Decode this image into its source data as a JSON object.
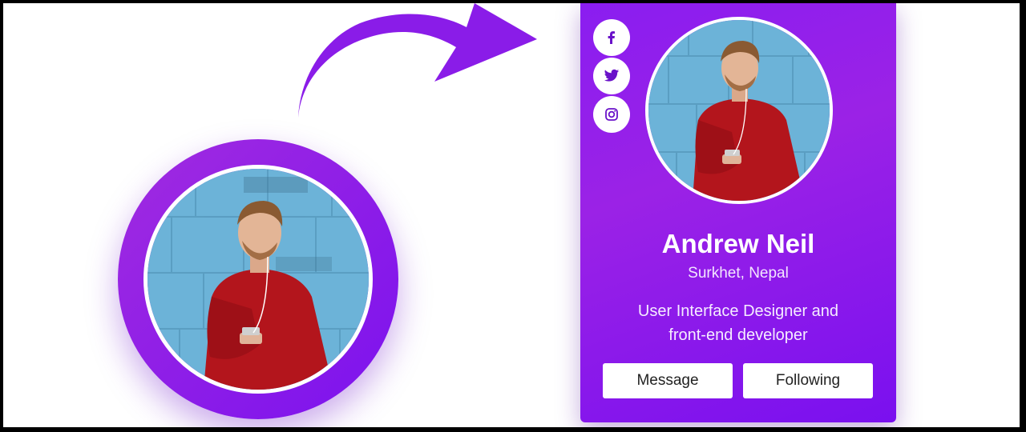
{
  "profile": {
    "name": "Andrew Neil",
    "location": "Surkhet, Nepal",
    "bio_line1": "User Interface Designer and",
    "bio_line2": "front-end developer"
  },
  "buttons": {
    "message_label": "Message",
    "following_label": "Following"
  },
  "socials": [
    "facebook-icon",
    "twitter-icon",
    "instagram-icon"
  ],
  "colors": {
    "accent": "#8a1df0",
    "accent_dark": "#7a10ef",
    "wall": "#6cb3d8",
    "sweater": "#b3151c"
  }
}
